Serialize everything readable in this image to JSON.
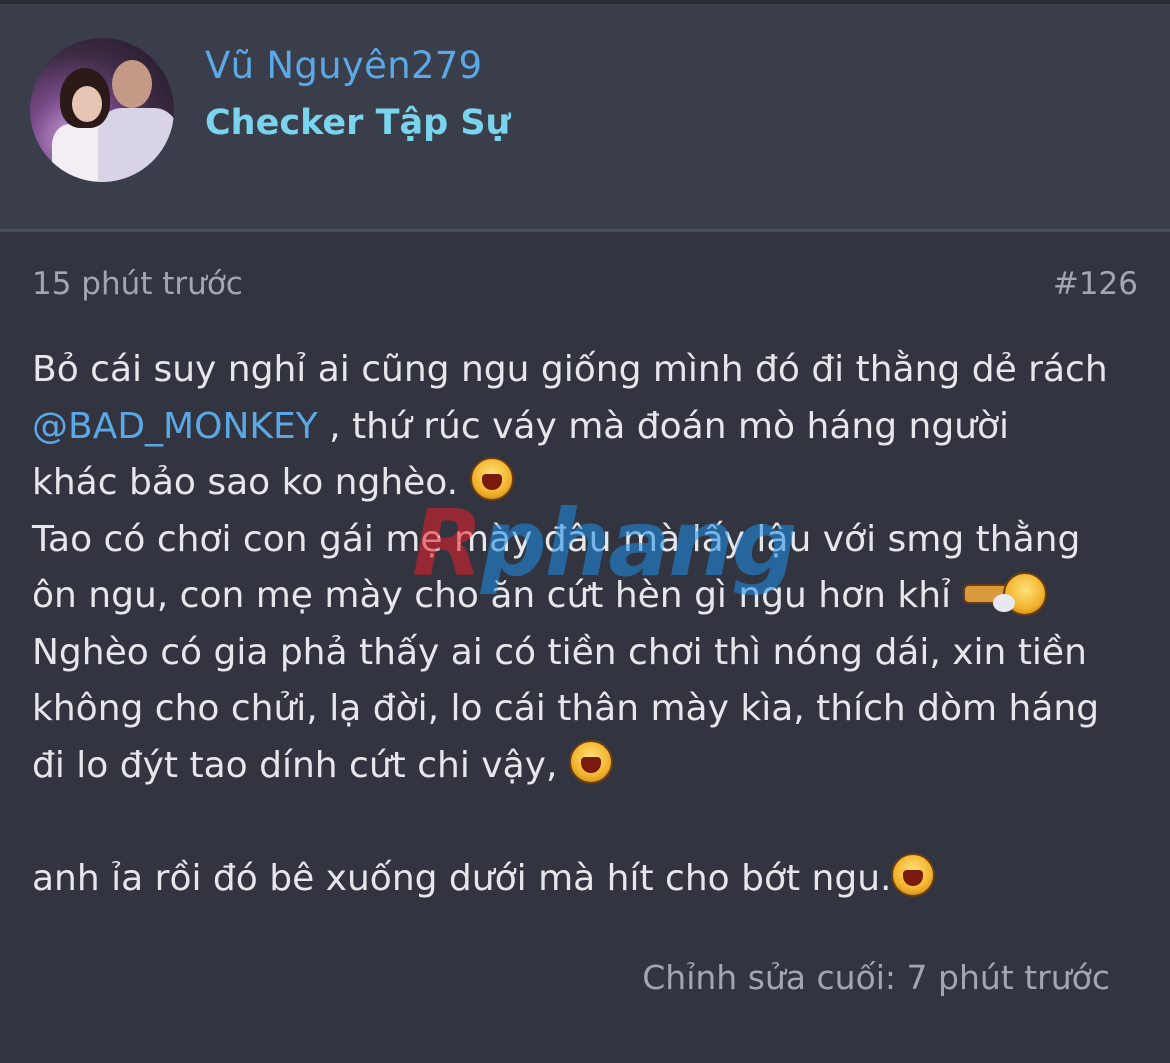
{
  "post": {
    "author": {
      "name": "Vũ Nguyên279",
      "title": "Checker Tập Sự"
    },
    "time": "15 phút trước",
    "number": "#126",
    "body": {
      "l1": "Bỏ cái suy nghỉ ai cũng ngu giống mình đó đi thằng dẻ rách",
      "mention": "@BAD_MONKEY",
      "l2_rest": " , thứ rúc váy mà đoán mò háng người",
      "l3": "khác bảo sao ko nghèo. ",
      "l4": "Tao có chơi con gái mẹ mày đâu mà lấy lậu với smg thằng",
      "l5": "ôn ngu, con mẹ mày cho ăn cứt hèn gì ngu hơn khỉ ",
      "l6": "Nghèo có gia phả thấy ai có tiền chơi thì nóng dái, xin tiền",
      "l7": "không cho chửi, lạ đời, lo cái thân mày kìa, thích dòm háng",
      "l8": "đi lo đýt tao dính cứt chi vậy, ",
      "l9": "anh ỉa rồi đó bê xuống dưới mà hít cho bớt ngu."
    },
    "edited": "Chỉnh sửa cuối: 7 phút trước"
  },
  "watermark": {
    "part1": "R",
    "part2": "phang"
  },
  "colors": {
    "background": "#32343f",
    "header": "#3a3e4a",
    "link": "#5ba8e6",
    "title": "#7ad4ee",
    "text": "#e6e7eb",
    "muted": "#a3a6b0"
  },
  "icons": {
    "emoji_laugh": "laughing-smiley-icon",
    "emoji_punch": "punch-smiley-icon"
  }
}
